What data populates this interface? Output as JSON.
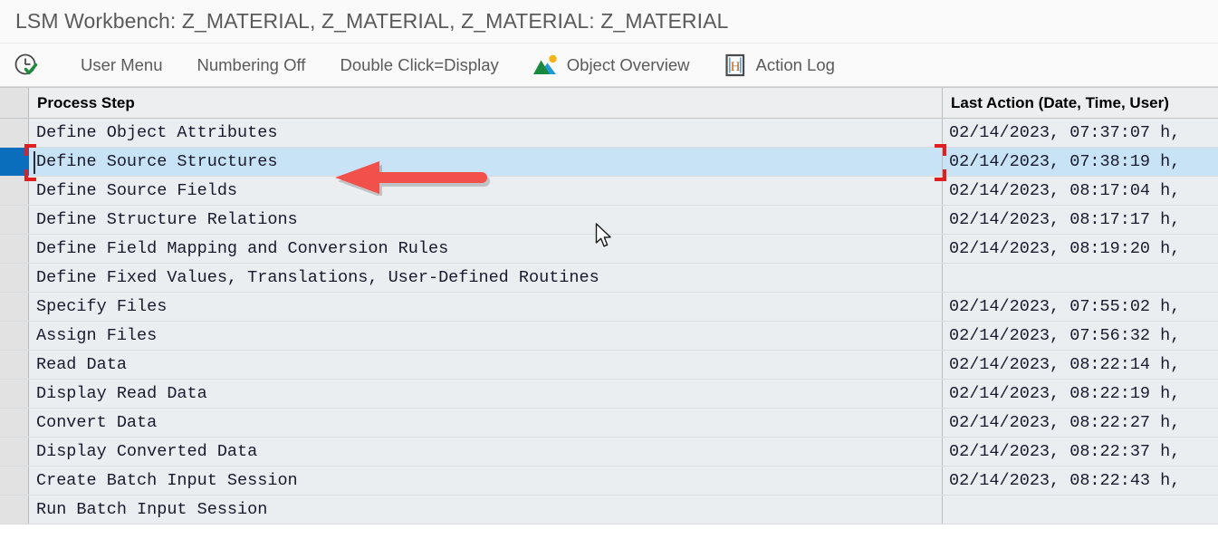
{
  "window": {
    "title": "LSM Workbench: Z_MATERIAL, Z_MATERIAL, Z_MATERIAL: Z_MATERIAL"
  },
  "toolbar": {
    "items": [
      {
        "icon": "clock-check-icon",
        "label": ""
      },
      {
        "icon": "",
        "label": "User Menu"
      },
      {
        "icon": "",
        "label": "Numbering Off"
      },
      {
        "icon": "",
        "label": "Double Click=Display"
      },
      {
        "icon": "image-overview-icon",
        "label": "Object Overview"
      },
      {
        "icon": "action-log-icon",
        "label": "Action Log"
      }
    ]
  },
  "table": {
    "columns": [
      {
        "key": "step",
        "label": "Process Step"
      },
      {
        "key": "action",
        "label": "Last Action (Date, Time, User)"
      }
    ],
    "rows": [
      {
        "step": "Define Object Attributes",
        "action": "02/14/2023, 07:37:07 h,"
      },
      {
        "step": "Define Source Structures",
        "action": "02/14/2023, 07:38:19 h,"
      },
      {
        "step": "Define Source Fields",
        "action": "02/14/2023, 08:17:04 h,"
      },
      {
        "step": "Define Structure Relations",
        "action": "02/14/2023, 08:17:17 h,"
      },
      {
        "step": "Define Field Mapping and Conversion Rules",
        "action": "02/14/2023, 08:19:20 h,"
      },
      {
        "step": "Define Fixed Values, Translations, User-Defined Routines",
        "action": ""
      },
      {
        "step": "Specify Files",
        "action": "02/14/2023, 07:55:02 h,"
      },
      {
        "step": "Assign Files",
        "action": "02/14/2023, 07:56:32 h,"
      },
      {
        "step": "Read Data",
        "action": "02/14/2023, 08:22:14 h,"
      },
      {
        "step": "Display Read Data",
        "action": "02/14/2023, 08:22:19 h,"
      },
      {
        "step": "Convert Data",
        "action": "02/14/2023, 08:22:27 h,"
      },
      {
        "step": "Display Converted Data",
        "action": "02/14/2023, 08:22:37 h,"
      },
      {
        "step": "Create Batch Input Session",
        "action": "02/14/2023, 08:22:43 h,"
      },
      {
        "step": "Run Batch Input Session",
        "action": ""
      }
    ],
    "selected_row_index": 1
  },
  "annotation": {
    "arrow": {
      "direction": "left",
      "color": "#f2504b",
      "points_at": "Define Source Structures"
    }
  },
  "colors": {
    "selection_gutter": "#0a6ebd",
    "selection_row": "#c7e3f5",
    "focus_bracket": "#e02020",
    "row_background": "#eaeef0",
    "gutter_background": "#e2e2e2",
    "title_text": "#5a5a5a"
  }
}
